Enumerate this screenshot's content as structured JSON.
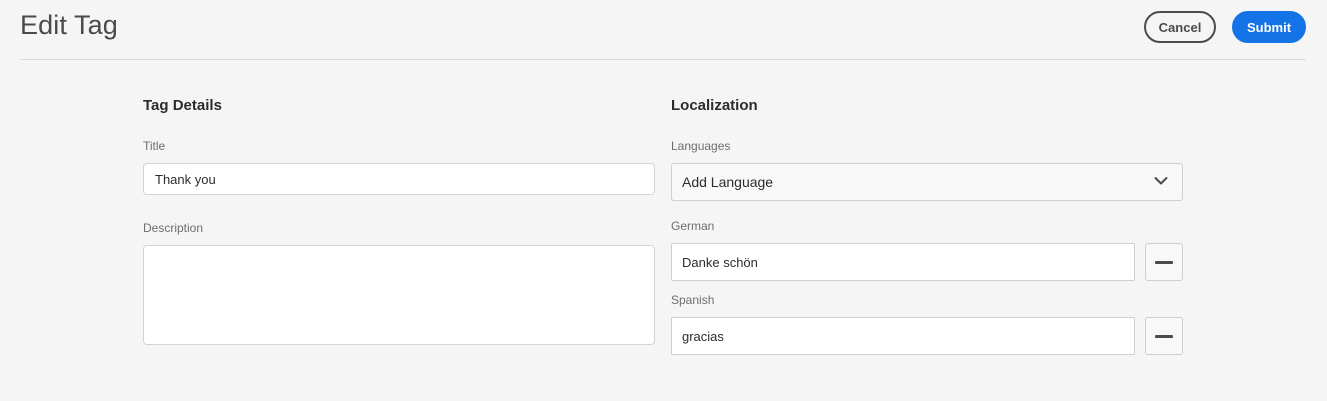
{
  "header": {
    "title": "Edit Tag",
    "cancel_label": "Cancel",
    "submit_label": "Submit"
  },
  "tag_details": {
    "heading": "Tag Details",
    "title_label": "Title",
    "title_value": "Thank you",
    "description_label": "Description",
    "description_value": ""
  },
  "localization": {
    "heading": "Localization",
    "languages_label": "Languages",
    "add_language_label": "Add Language",
    "translations": [
      {
        "language": "German",
        "value": "Danke schön"
      },
      {
        "language": "Spanish",
        "value": "gracias"
      }
    ]
  },
  "icons": {
    "dropdown": "chevron-down-icon",
    "remove": "minus-icon"
  },
  "colors": {
    "accent": "#1473e6",
    "background": "#f5f5f5"
  }
}
